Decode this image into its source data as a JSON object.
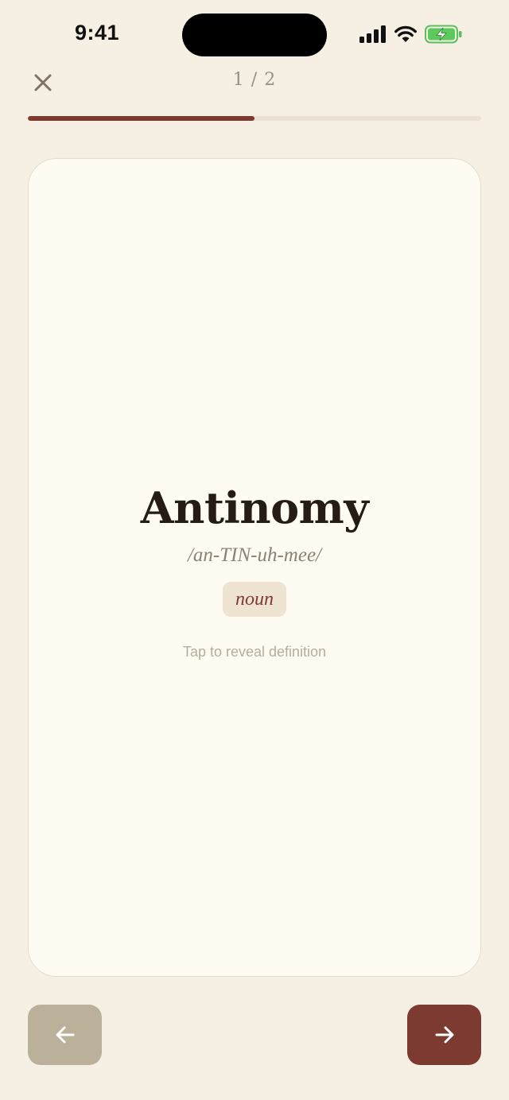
{
  "status_bar": {
    "time": "9:41"
  },
  "header": {
    "close_icon": "close-icon",
    "counter": "1 / 2"
  },
  "progress": {
    "fraction": 0.5
  },
  "card": {
    "word": "Antinomy",
    "pronunciation": "/an-TIN-uh-mee/",
    "part_of_speech": "noun",
    "hint": "Tap to reveal definition"
  },
  "navigation": {
    "prev_icon": "arrow-left-icon",
    "next_icon": "arrow-right-icon"
  },
  "colors": {
    "background": "#f6f0e4",
    "card": "#fefbf3",
    "accent": "#7d3a30",
    "muted_button": "#bbb09a"
  }
}
